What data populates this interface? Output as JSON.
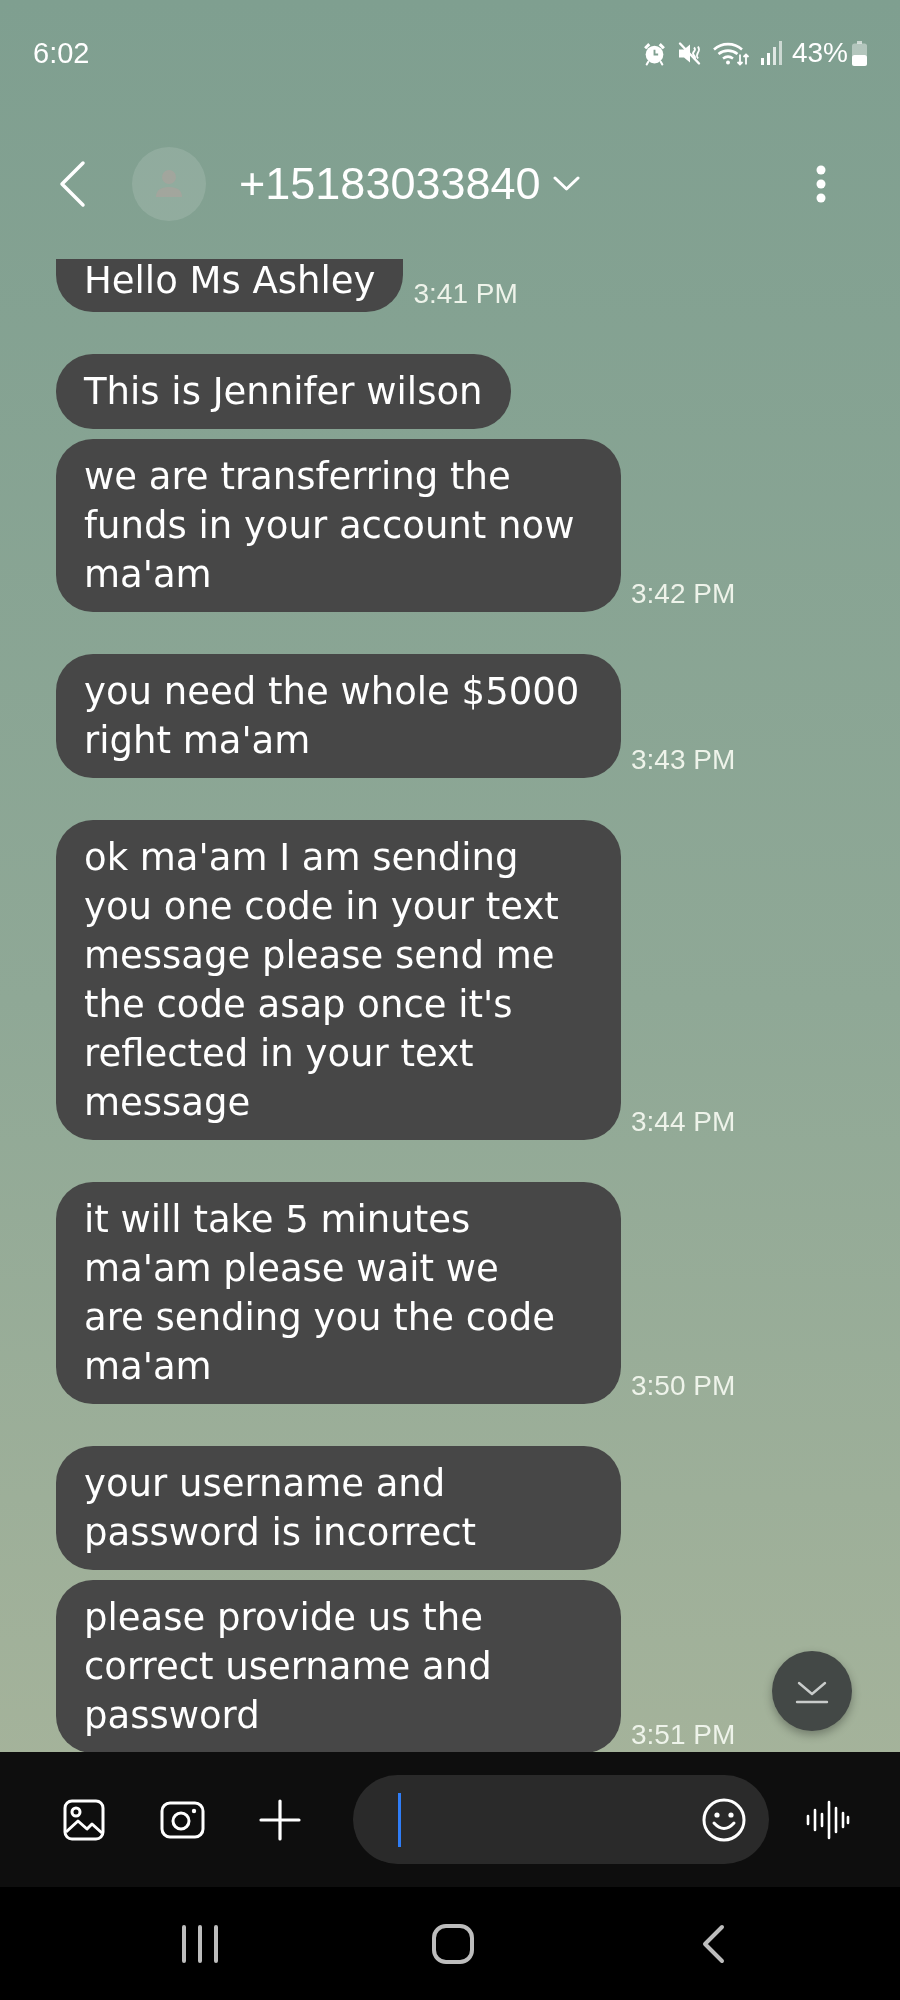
{
  "status_bar": {
    "time": "6:02",
    "battery": "43%"
  },
  "header": {
    "contact": "+15183033840"
  },
  "messages": [
    {
      "text": "Hello Ms Ashley",
      "time": "3:41 PM"
    },
    {
      "text": "This is Jennifer wilson"
    },
    {
      "text": "we are transferring the\nfunds in your account now\nma'am",
      "time": "3:42 PM"
    },
    {
      "text": "you need the whole $5000\nright ma'am",
      "time": "3:43 PM"
    },
    {
      "text": "ok ma'am I am sending\nyou one code in your text\nmessage please send me\nthe code asap once it's\nreflected in your text\nmessage",
      "time": "3:44 PM"
    },
    {
      "text": "it will take 5 minutes\nma'am please wait we\nare sending you the code\nma'am",
      "time": "3:50 PM"
    },
    {
      "text": "your username and\npassword is incorrect"
    },
    {
      "text": "please provide us the\ncorrect username and\npassword",
      "time": "3:51 PM"
    }
  ]
}
